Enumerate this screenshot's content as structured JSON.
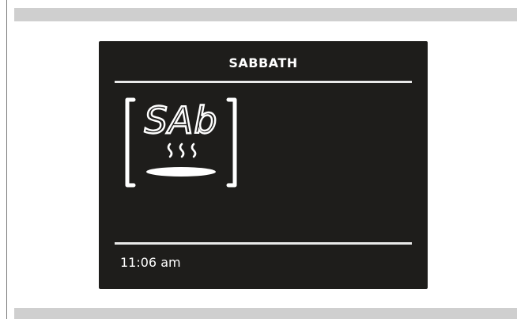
{
  "display": {
    "title": "SABBATH",
    "mode_code": "SAb",
    "time": "11:06 am"
  },
  "icons": {
    "mode": "sabbath-mode-icon"
  },
  "colors": {
    "screen_background": "#1e1d1b",
    "foreground": "#ffffff",
    "outer_band": "#cfcfcf"
  }
}
